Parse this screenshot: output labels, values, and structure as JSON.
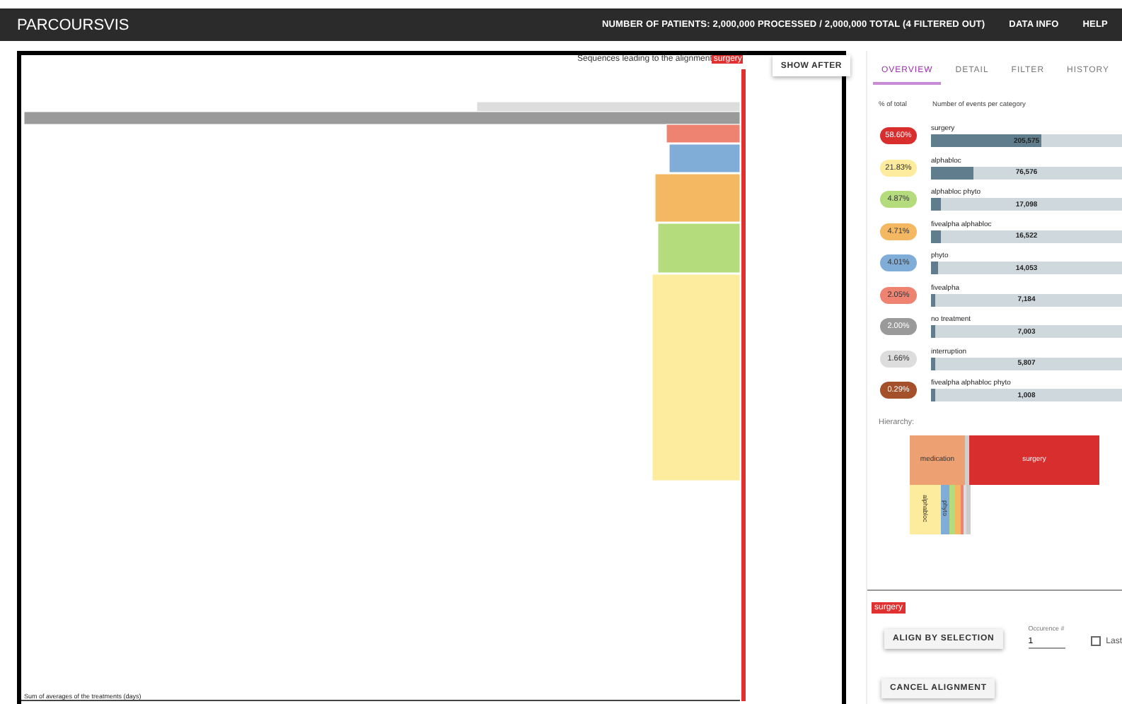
{
  "app_bar": {
    "title": "PARCOURSVIS",
    "patients": "NUMBER OF PATIENTS: 2,000,000 PROCESSED / 2,000,000 TOTAL (4 FILTERED OUT)",
    "links": [
      "DATA INFO",
      "HELP"
    ]
  },
  "chart": {
    "title": "Sequences leading to the alignment",
    "alignment_tag": "surgery",
    "show_after": "SHOW AFTER",
    "xlabel": "Sum of averages of the treatments (days)"
  },
  "tabs": [
    {
      "label": "OVERVIEW",
      "selected": true
    },
    {
      "label": "DETAIL",
      "selected": false
    },
    {
      "label": "FILTER",
      "selected": false
    },
    {
      "label": "HISTORY",
      "selected": false
    }
  ],
  "overview": {
    "pct_header": "% of total",
    "count_header": "Number of events per category",
    "categories": [
      {
        "percent": "58.60%",
        "name": "surgery",
        "count": "205,575",
        "level": 0.58,
        "color": "#d92e2e"
      },
      {
        "percent": "21.83%",
        "name": "alphabloc",
        "count": "76,576",
        "level": 0.22,
        "color": "#fdec9e"
      },
      {
        "percent": "4.87%",
        "name": "alphabloc phyto",
        "count": "17,098",
        "level": 0.05,
        "color": "#b5dc7c"
      },
      {
        "percent": "4.71%",
        "name": "fivealpha alphabloc",
        "count": "16,522",
        "level": 0.05,
        "color": "#f4b862"
      },
      {
        "percent": "4.01%",
        "name": "phyto",
        "count": "14,053",
        "level": 0.04,
        "color": "#80add8"
      },
      {
        "percent": "2.05%",
        "name": "fivealpha",
        "count": "7,184",
        "level": 0.02,
        "color": "#ef8372"
      },
      {
        "percent": "2.00%",
        "name": "no treatment",
        "count": "7,003",
        "level": 0.02,
        "color": "#9a9a9a"
      },
      {
        "percent": "1.66%",
        "name": "interruption",
        "count": "5,807",
        "level": 0.02,
        "color": "#dddddd"
      },
      {
        "percent": "0.29%",
        "name": "fivealpha alphabloc phyto",
        "count": "1,008",
        "level": 0.01,
        "color": "#a4502a"
      }
    ],
    "hierarchy_label": "Hierarchy:",
    "hierarchy_labels": [
      "medication",
      "surgery",
      "alphabloc",
      "phyto"
    ]
  },
  "alignment": {
    "tag": "surgery",
    "align_button": "ALIGN BY SELECTION",
    "occurrence_label": "Occurence #",
    "occurrence_value": "1",
    "last_label": "Last",
    "last_checked": false,
    "cancel_button": "CANCEL ALIGNMENT"
  }
}
